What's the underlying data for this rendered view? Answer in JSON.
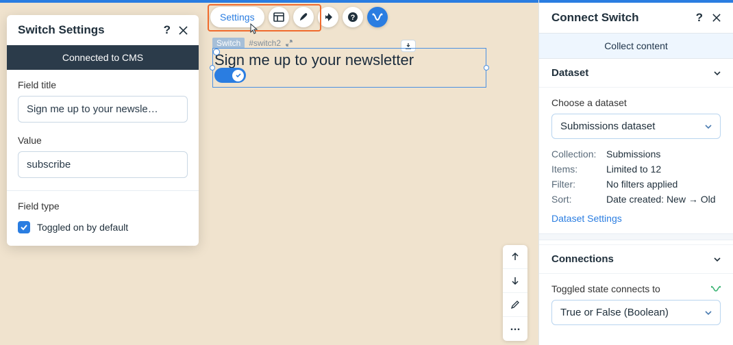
{
  "left_panel": {
    "title": "Switch Settings",
    "banner": "Connected to CMS",
    "field_title_label": "Field title",
    "field_title_value": "Sign me up to your newsle…",
    "value_label": "Value",
    "value_value": "subscribe",
    "field_type_label": "Field type",
    "toggle_default_label": "Toggled on by default"
  },
  "toolbar": {
    "settings_label": "Settings"
  },
  "canvas": {
    "element_type": "Switch",
    "element_id": "#switch2",
    "element_text": "Sign me up to your newsletter"
  },
  "right_panel": {
    "title": "Connect Switch",
    "collect_label": "Collect content",
    "dataset_section": "Dataset",
    "choose_label": "Choose a dataset",
    "dataset_value": "Submissions dataset",
    "meta": {
      "collection_k": "Collection:",
      "collection_v": "Submissions",
      "items_k": "Items:",
      "items_v": "Limited to 12",
      "filter_k": "Filter:",
      "filter_v": "No filters applied",
      "sort_k": "Sort:",
      "sort_v": "Date created: New → Old"
    },
    "dataset_settings_link": "Dataset Settings",
    "connections_section": "Connections",
    "connects_label": "Toggled state connects to",
    "connects_value": "True or False (Boolean)"
  }
}
